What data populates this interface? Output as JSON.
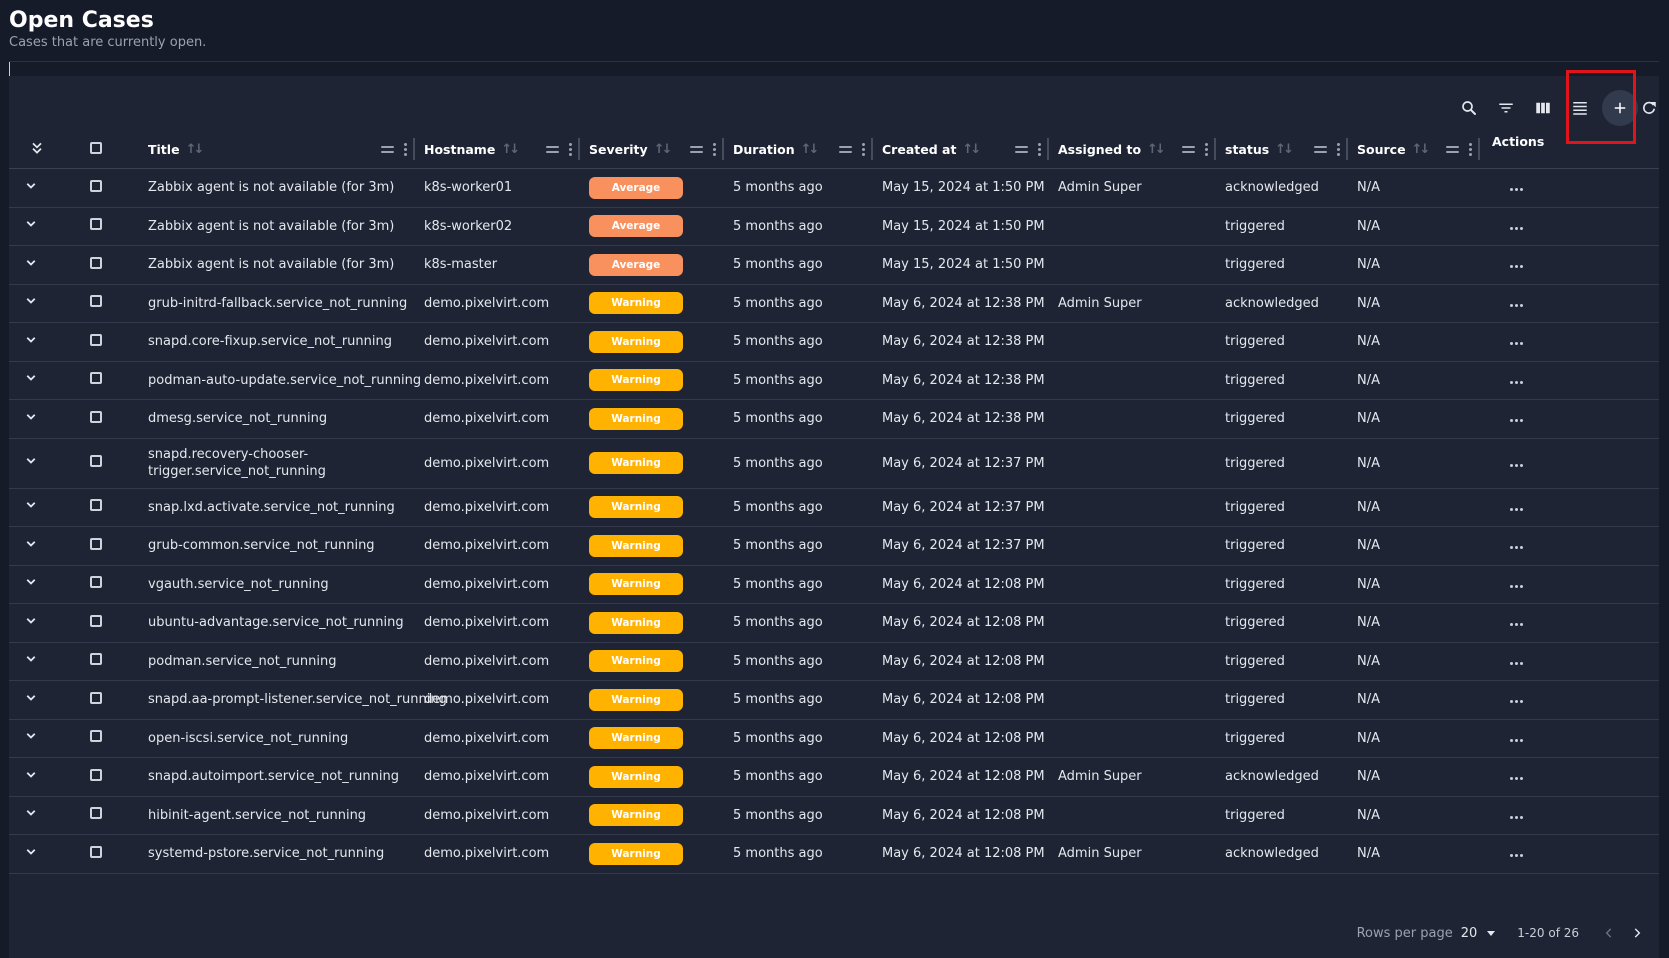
{
  "page": {
    "title": "Open Cases",
    "subtitle": "Cases that are currently open."
  },
  "toolbar": {
    "icons": [
      "search-icon",
      "filter-icon",
      "columns-icon",
      "density-icon",
      "add-icon",
      "refresh-icon"
    ]
  },
  "columns": {
    "title": "Title",
    "hostname": "Hostname",
    "severity": "Severity",
    "duration": "Duration",
    "created_at": "Created at",
    "assigned_to": "Assigned to",
    "status": "status",
    "source": "Source",
    "actions": "Actions"
  },
  "rows": [
    {
      "title": "Zabbix agent is not available (for 3m)",
      "hostname": "k8s-worker01",
      "severity": "Average",
      "duration": "5 months ago",
      "created_at": "May 15, 2024 at 1:50 PM",
      "assigned_to": "Admin Super",
      "status": "acknowledged",
      "source": "N/A"
    },
    {
      "title": "Zabbix agent is not available (for 3m)",
      "hostname": "k8s-worker02",
      "severity": "Average",
      "duration": "5 months ago",
      "created_at": "May 15, 2024 at 1:50 PM",
      "assigned_to": "",
      "status": "triggered",
      "source": "N/A"
    },
    {
      "title": "Zabbix agent is not available (for 3m)",
      "hostname": "k8s-master",
      "severity": "Average",
      "duration": "5 months ago",
      "created_at": "May 15, 2024 at 1:50 PM",
      "assigned_to": "",
      "status": "triggered",
      "source": "N/A"
    },
    {
      "title": "grub-initrd-fallback.service_not_running",
      "hostname": "demo.pixelvirt.com",
      "severity": "Warning",
      "duration": "5 months ago",
      "created_at": "May 6, 2024 at 12:38 PM",
      "assigned_to": "Admin Super",
      "status": "acknowledged",
      "source": "N/A"
    },
    {
      "title": "snapd.core-fixup.service_not_running",
      "hostname": "demo.pixelvirt.com",
      "severity": "Warning",
      "duration": "5 months ago",
      "created_at": "May 6, 2024 at 12:38 PM",
      "assigned_to": "",
      "status": "triggered",
      "source": "N/A"
    },
    {
      "title": "podman-auto-update.service_not_running",
      "hostname": "demo.pixelvirt.com",
      "severity": "Warning",
      "duration": "5 months ago",
      "created_at": "May 6, 2024 at 12:38 PM",
      "assigned_to": "",
      "status": "triggered",
      "source": "N/A"
    },
    {
      "title": "dmesg.service_not_running",
      "hostname": "demo.pixelvirt.com",
      "severity": "Warning",
      "duration": "5 months ago",
      "created_at": "May 6, 2024 at 12:38 PM",
      "assigned_to": "",
      "status": "triggered",
      "source": "N/A"
    },
    {
      "title": "snapd.recovery-chooser-trigger.service_not_running",
      "hostname": "demo.pixelvirt.com",
      "severity": "Warning",
      "duration": "5 months ago",
      "created_at": "May 6, 2024 at 12:37 PM",
      "assigned_to": "",
      "status": "triggered",
      "source": "N/A"
    },
    {
      "title": "snap.lxd.activate.service_not_running",
      "hostname": "demo.pixelvirt.com",
      "severity": "Warning",
      "duration": "5 months ago",
      "created_at": "May 6, 2024 at 12:37 PM",
      "assigned_to": "",
      "status": "triggered",
      "source": "N/A"
    },
    {
      "title": "grub-common.service_not_running",
      "hostname": "demo.pixelvirt.com",
      "severity": "Warning",
      "duration": "5 months ago",
      "created_at": "May 6, 2024 at 12:37 PM",
      "assigned_to": "",
      "status": "triggered",
      "source": "N/A"
    },
    {
      "title": "vgauth.service_not_running",
      "hostname": "demo.pixelvirt.com",
      "severity": "Warning",
      "duration": "5 months ago",
      "created_at": "May 6, 2024 at 12:08 PM",
      "assigned_to": "",
      "status": "triggered",
      "source": "N/A"
    },
    {
      "title": "ubuntu-advantage.service_not_running",
      "hostname": "demo.pixelvirt.com",
      "severity": "Warning",
      "duration": "5 months ago",
      "created_at": "May 6, 2024 at 12:08 PM",
      "assigned_to": "",
      "status": "triggered",
      "source": "N/A"
    },
    {
      "title": "podman.service_not_running",
      "hostname": "demo.pixelvirt.com",
      "severity": "Warning",
      "duration": "5 months ago",
      "created_at": "May 6, 2024 at 12:08 PM",
      "assigned_to": "",
      "status": "triggered",
      "source": "N/A"
    },
    {
      "title": "snapd.aa-prompt-listener.service_not_running",
      "hostname": "demo.pixelvirt.com",
      "severity": "Warning",
      "duration": "5 months ago",
      "created_at": "May 6, 2024 at 12:08 PM",
      "assigned_to": "",
      "status": "triggered",
      "source": "N/A"
    },
    {
      "title": "open-iscsi.service_not_running",
      "hostname": "demo.pixelvirt.com",
      "severity": "Warning",
      "duration": "5 months ago",
      "created_at": "May 6, 2024 at 12:08 PM",
      "assigned_to": "",
      "status": "triggered",
      "source": "N/A"
    },
    {
      "title": "snapd.autoimport.service_not_running",
      "hostname": "demo.pixelvirt.com",
      "severity": "Warning",
      "duration": "5 months ago",
      "created_at": "May 6, 2024 at 12:08 PM",
      "assigned_to": "Admin Super",
      "status": "acknowledged",
      "source": "N/A"
    },
    {
      "title": "hibinit-agent.service_not_running",
      "hostname": "demo.pixelvirt.com",
      "severity": "Warning",
      "duration": "5 months ago",
      "created_at": "May 6, 2024 at 12:08 PM",
      "assigned_to": "",
      "status": "triggered",
      "source": "N/A"
    },
    {
      "title": "systemd-pstore.service_not_running",
      "hostname": "demo.pixelvirt.com",
      "severity": "Warning",
      "duration": "5 months ago",
      "created_at": "May 6, 2024 at 12:08 PM",
      "assigned_to": "Admin Super",
      "status": "acknowledged",
      "source": "N/A"
    }
  ],
  "pagination": {
    "rows_per_page_label": "Rows per page",
    "rows_per_page": "20",
    "range": "1-20 of 26"
  },
  "colors": {
    "background": "#161b29",
    "panel": "#1e2433",
    "severity_average": "#f8915d",
    "severity_warning": "#ffb200",
    "highlight": "#e0141b"
  }
}
